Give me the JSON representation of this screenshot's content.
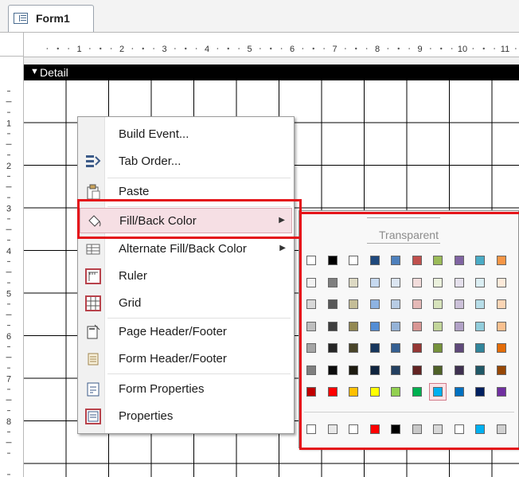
{
  "tab": {
    "title": "Form1"
  },
  "ruler": {
    "h_labels": [
      "1",
      "2",
      "3",
      "4",
      "5",
      "6",
      "7",
      "8",
      "9",
      "10",
      "11"
    ],
    "v_labels": [
      "1",
      "2",
      "3",
      "4",
      "5",
      "6",
      "7",
      "8"
    ]
  },
  "section": {
    "title": "Detail"
  },
  "menu": {
    "items": [
      {
        "label": "Build Event...",
        "icon": "none"
      },
      {
        "label": "Tab Order...",
        "icon": "tab-order-icon"
      },
      {
        "label": "Paste",
        "icon": "clipboard-icon"
      },
      {
        "label": "Fill/Back Color",
        "icon": "paint-bucket-icon",
        "submenu": true
      },
      {
        "label": "Alternate Fill/Back Color",
        "icon": "alternate-fill-icon",
        "submenu": true
      },
      {
        "label": "Ruler",
        "icon": "ruler-icon"
      },
      {
        "label": "Grid",
        "icon": "grid-icon"
      },
      {
        "label": "Page Header/Footer",
        "icon": "page-header-icon"
      },
      {
        "label": "Form Header/Footer",
        "icon": "form-header-icon"
      },
      {
        "label": "Form Properties",
        "icon": "form-properties-icon"
      },
      {
        "label": "Properties",
        "icon": "properties-icon"
      }
    ]
  },
  "palette": {
    "transparent_label": "Transparent",
    "rows": [
      [
        "#ffffff",
        "#000000",
        "#ffffff",
        "#1f497d",
        "#4f81bd",
        "#c0504d",
        "#9bbb59",
        "#8064a2",
        "#4bacc6",
        "#f79646"
      ],
      [
        "#f2f2f2",
        "#7f7f7f",
        "#ddd9c3",
        "#c6d9f0",
        "#dbe5f1",
        "#f2dcdb",
        "#ebf1dd",
        "#e5e0ec",
        "#dbeef3",
        "#fdeada"
      ],
      [
        "#d8d8d8",
        "#595959",
        "#c4bd97",
        "#8db3e2",
        "#b8cce4",
        "#e5b9b7",
        "#d7e3bc",
        "#ccc1d9",
        "#b7dde8",
        "#fbd5b5"
      ],
      [
        "#bfbfbf",
        "#3f3f3f",
        "#938953",
        "#548dd4",
        "#95b3d7",
        "#d99694",
        "#c3d69b",
        "#b2a2c7",
        "#92cddc",
        "#fac08f"
      ],
      [
        "#a5a5a5",
        "#262626",
        "#494429",
        "#17365d",
        "#366092",
        "#953734",
        "#76923c",
        "#5f497a",
        "#31859b",
        "#e36c09"
      ],
      [
        "#7f7f7f",
        "#0c0c0c",
        "#1d1b10",
        "#0f243e",
        "#244061",
        "#632423",
        "#4f6128",
        "#3f3151",
        "#205867",
        "#974806"
      ],
      [
        "#c00000",
        "#ff0000",
        "#ffc000",
        "#ffff00",
        "#92d050",
        "#00b050",
        "#00b0f0",
        "#0070c0",
        "#002060",
        "#7030a0"
      ]
    ],
    "recent": [
      "#ffffff",
      "#e8e8e8",
      "#ffffff",
      "#ff0000",
      "#000000",
      "#c8c8c8",
      "#d8d8d8",
      "#ffffff",
      "#00b0f0",
      "#d0d0d0"
    ],
    "selected": "#00b0f0"
  }
}
